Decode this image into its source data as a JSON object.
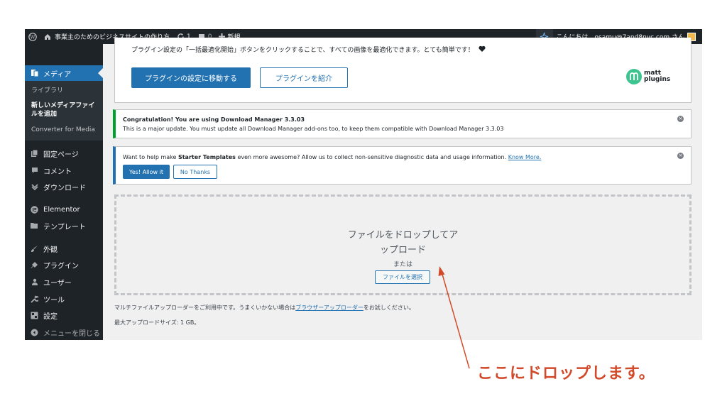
{
  "admin_bar": {
    "site_name": "事業主のためのビジネスサイトの作り方",
    "updates_count": "1",
    "comments_count": "0",
    "new_label": "新規",
    "greeting": "こんにちは、osamu@7and8nyc.com さん"
  },
  "sidebar": {
    "media_label": "メディア",
    "submenu": [
      "ライブラリ",
      "新しいメディアファイ",
      "ルを追加",
      "Converter for Media"
    ],
    "items": [
      {
        "label": "固定ページ",
        "icon": "page-icon"
      },
      {
        "label": "コメント",
        "icon": "comment-icon"
      },
      {
        "label": "ダウンロード",
        "icon": "download-icon"
      },
      {
        "label": "Elementor",
        "icon": "elementor-icon"
      },
      {
        "label": "テンプレート",
        "icon": "folder-icon"
      },
      {
        "label": "外観",
        "icon": "brush-icon"
      },
      {
        "label": "プラグイン",
        "icon": "plugin-icon"
      },
      {
        "label": "ユーザー",
        "icon": "user-icon"
      },
      {
        "label": "ツール",
        "icon": "wrench-icon"
      },
      {
        "label": "設定",
        "icon": "settings-icon"
      },
      {
        "label": "メニューを閉じる",
        "icon": "collapse-icon"
      }
    ]
  },
  "plugin_notice": {
    "text": "プラグイン設定の「一括最適化開始」ボタンをクリックすることで、すべての画像を最適化できます。とても簡単です！",
    "primary_button": "プラグインの設定に移動する",
    "secondary_button": "プラグインを紹介",
    "logo_text_1": "matt",
    "logo_text_2": "plugins"
  },
  "download_notice": {
    "title": "Congratulation! You are using Download Manager 3.3.03",
    "body": "This is a major update. You must update all Download Manager add-ons too, to keep them compatible with Download Manager 3.3.03"
  },
  "starter_notice": {
    "text_before": "Want to help make ",
    "text_bold": "Starter Templates",
    "text_after": " even more awesome? Allow us to collect non-sensitive diagnostic data and usage information. ",
    "link": "Know More.",
    "allow_button": "Yes! Allow it",
    "deny_button": "No Thanks"
  },
  "upload": {
    "drop_line_1": "ファイルをドロップしてア",
    "drop_line_2": "ップロード",
    "or": "または",
    "select_button": "ファイルを選択",
    "note_before": "マルチファイルアップローダーをご利用中です。うまくいかない場合は",
    "note_link": "ブラウザーアップローダー",
    "note_after": "をお試しください。",
    "max_size": "最大アップロードサイズ: 1 GB。"
  },
  "annotation": {
    "text": "ここにドロップします。",
    "color": "#d24a2a"
  }
}
